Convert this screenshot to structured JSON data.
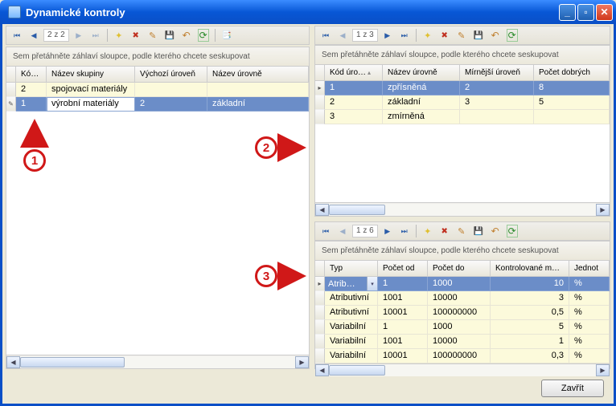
{
  "window": {
    "title": "Dynamické kontroly"
  },
  "toolbar": {
    "main_counter": "2 z 2",
    "sub1_counter": "1 z 3",
    "sub2_counter": "1 z 6"
  },
  "group_hint": "Sem přetáhněte záhlaví sloupce, podle kterého chcete seskupovat",
  "grid1": {
    "cols": [
      "Kó…",
      "Název skupiny",
      "Výchozí úroveň",
      "Název úrovně"
    ],
    "rows": [
      {
        "ind": "",
        "c": [
          "2",
          "spojovací materiály",
          "",
          ""
        ],
        "style": "yellow"
      },
      {
        "ind": "✎",
        "c": [
          "1",
          "výrobní materiály",
          "2",
          "základní"
        ],
        "style": "sel",
        "editing": 1
      }
    ]
  },
  "grid2": {
    "cols": [
      "Kód úro…",
      "Název úrovně",
      "Mírnější úroveň",
      "Počet dobrých"
    ],
    "rows": [
      {
        "ind": "▸",
        "c": [
          "1",
          "zpřísněná",
          "2",
          "8"
        ],
        "style": "sel"
      },
      {
        "ind": "",
        "c": [
          "2",
          "základní",
          "3",
          "5"
        ],
        "style": "yellow"
      },
      {
        "ind": "",
        "c": [
          "3",
          "zmírněná",
          "",
          ""
        ],
        "style": "yellow"
      }
    ]
  },
  "grid3": {
    "cols": [
      "Typ",
      "Počet od",
      "Počet do",
      "Kontrolované m…",
      "Jednot"
    ],
    "rows": [
      {
        "ind": "▸",
        "c": [
          "Atrib…",
          "1",
          "1000",
          "10",
          "%"
        ],
        "style": "sel",
        "dropdown": true
      },
      {
        "ind": "",
        "c": [
          "Atributivní",
          "1001",
          "10000",
          "3",
          "%"
        ],
        "style": "yellow"
      },
      {
        "ind": "",
        "c": [
          "Atributivní",
          "10001",
          "100000000",
          "0,5",
          "%"
        ],
        "style": "yellow"
      },
      {
        "ind": "",
        "c": [
          "Variabilní",
          "1",
          "1000",
          "5",
          "%"
        ],
        "style": "yellow"
      },
      {
        "ind": "",
        "c": [
          "Variabilní",
          "1001",
          "10000",
          "1",
          "%"
        ],
        "style": "yellow"
      },
      {
        "ind": "",
        "c": [
          "Variabilní",
          "10001",
          "100000000",
          "0,3",
          "%"
        ],
        "style": "yellow"
      }
    ]
  },
  "callouts": {
    "c1": "1",
    "c2": "2",
    "c3": "3"
  },
  "footer": {
    "close": "Zavřít"
  }
}
